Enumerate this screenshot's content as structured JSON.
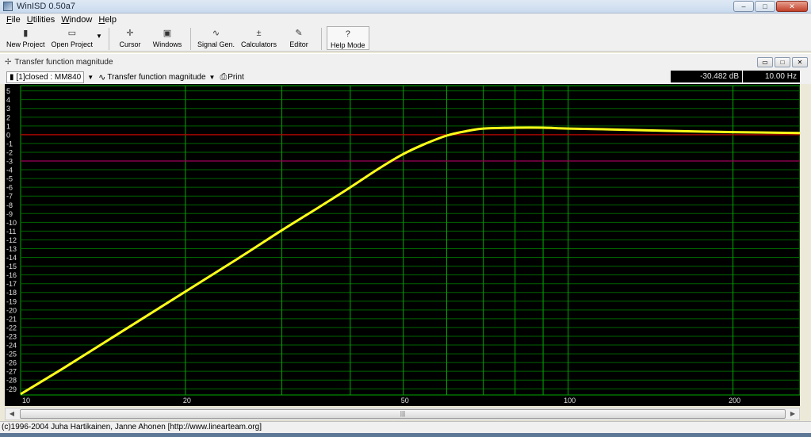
{
  "window": {
    "title": "WinISD 0.50a7",
    "minimize": "–",
    "maximize": "□",
    "close": "✕"
  },
  "menu": [
    {
      "key": "F",
      "rest": "ile"
    },
    {
      "key": "U",
      "rest": "tilities"
    },
    {
      "key": "W",
      "rest": "indow"
    },
    {
      "key": "H",
      "rest": "elp"
    }
  ],
  "toolbar": {
    "new_project": {
      "label": "New Project",
      "icon": "document-icon",
      "glyph": "▮"
    },
    "open_project": {
      "label": "Open Project",
      "icon": "folder-icon",
      "glyph": "▭"
    },
    "cursor": {
      "label": "Cursor",
      "icon": "crosshair-icon",
      "glyph": "✛"
    },
    "windows": {
      "label": "Windows",
      "icon": "windows-icon",
      "glyph": "▣"
    },
    "signal_gen": {
      "label": "Signal Gen.",
      "icon": "sine-wave-icon",
      "glyph": "∿"
    },
    "calculators": {
      "label": "Calculators",
      "icon": "calculator-icon",
      "glyph": "±"
    },
    "editor": {
      "label": "Editor",
      "icon": "editor-icon",
      "glyph": "✎"
    },
    "help_mode": {
      "label": "Help Mode",
      "icon": "question-icon",
      "glyph": "?"
    }
  },
  "child_window": {
    "title": "Transfer function magnitude",
    "buttons": [
      "▭",
      "□",
      "✕"
    ]
  },
  "chart_toolbar": {
    "project_select": "[1]closed : MM840",
    "graph_select": "Transfer function magnitude",
    "print_label": "Print",
    "db_readout": "-30.482 dB",
    "hz_readout": "10.00 Hz"
  },
  "statusbar": {
    "text": "(c)1996-2004 Juha Hartikainen, Janne Ahonen [http://www.linearteam.org]"
  },
  "scrollbar": {
    "left_arrow": "◀",
    "right_arrow": "▶",
    "grip": "|||"
  },
  "colors": {
    "background": "#000000",
    "grid_major": "#00aa00",
    "grid_minor": "#006400",
    "curve": "#ffff1a",
    "zero_line": "#c00000",
    "minus3_line": "#a0005a"
  },
  "chart_data": {
    "type": "line",
    "title": "Transfer function magnitude",
    "x_scale": "log",
    "xlim": [
      10,
      265
    ],
    "ylim": [
      -29.7,
      5.6
    ],
    "x_tick_labels": [
      10,
      20,
      50,
      100,
      200
    ],
    "y_ticks": [
      5,
      4,
      3,
      2,
      1,
      0,
      -1,
      -2,
      -3,
      -4,
      -5,
      -6,
      -7,
      -8,
      -9,
      -10,
      -11,
      -12,
      -13,
      -14,
      -15,
      -16,
      -17,
      -18,
      -19,
      -20,
      -21,
      -22,
      -23,
      -24,
      -25,
      -26,
      -27,
      -28,
      -29
    ],
    "x_gridlines": [
      20,
      30,
      40,
      50,
      60,
      70,
      80,
      90,
      100,
      200
    ],
    "reference_lines": [
      {
        "y": 0,
        "color": "#c00000"
      },
      {
        "y": -3,
        "color": "#a0005a"
      }
    ],
    "grid": true,
    "series": [
      {
        "x": [
          10,
          12,
          15,
          20,
          25,
          30,
          35,
          40,
          45,
          50,
          55,
          60,
          65,
          70,
          80,
          90,
          100,
          120,
          150,
          200,
          265
        ],
        "y": [
          -29.6,
          -26.6,
          -22.8,
          -17.9,
          -14.1,
          -10.9,
          -8.3,
          -6.0,
          -3.9,
          -2.2,
          -1.0,
          -0.1,
          0.4,
          0.7,
          0.8,
          0.8,
          0.7,
          0.6,
          0.45,
          0.3,
          0.2
        ]
      }
    ]
  }
}
